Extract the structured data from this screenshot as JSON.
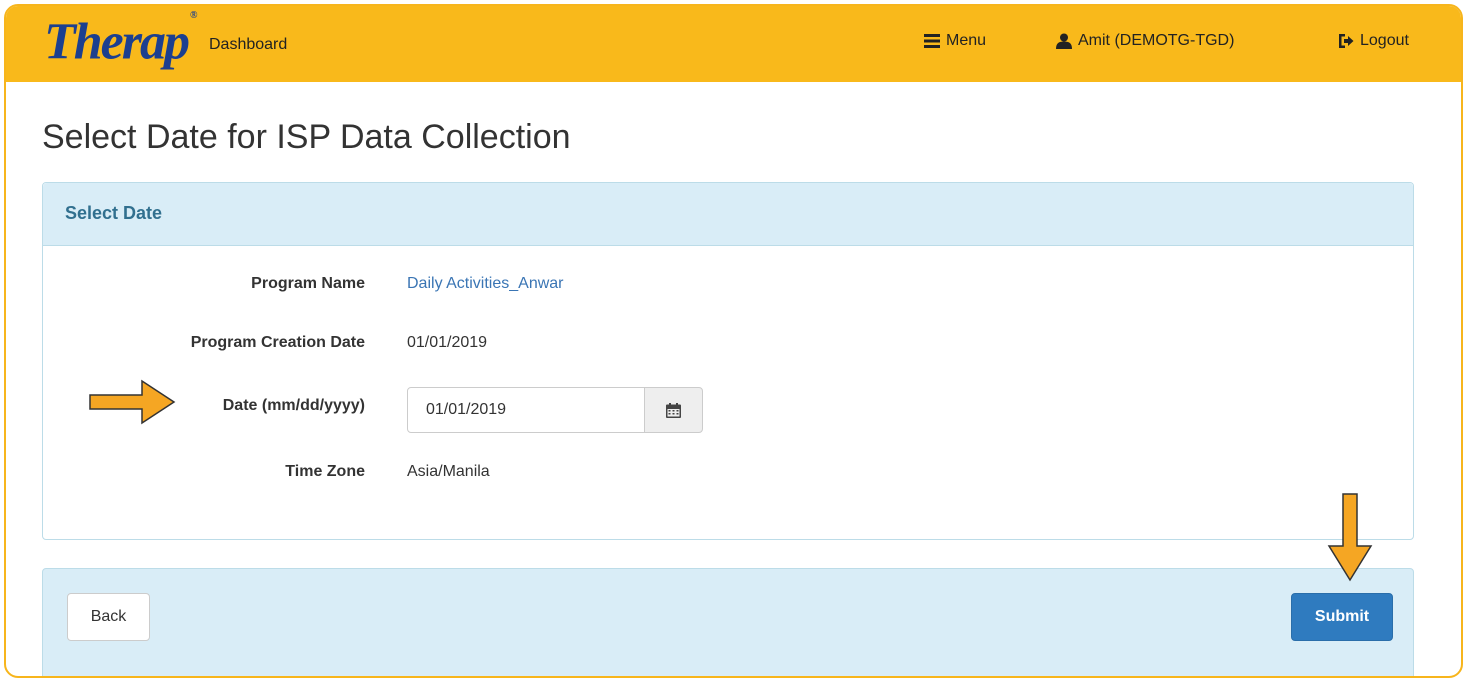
{
  "header": {
    "logo_text": "Therap",
    "dashboard_label": "Dashboard",
    "menu_label": "Menu",
    "user_label": "Amit (DEMOTG-TGD)",
    "logout_label": "Logout",
    "brand_color": "#f9b91b"
  },
  "page": {
    "title": "Select Date for ISP Data Collection"
  },
  "panel": {
    "title": "Select Date",
    "fields": {
      "program_name_label": "Program Name",
      "program_name_value": "Daily Activities_Anwar",
      "creation_date_label": "Program Creation Date",
      "creation_date_value": "01/01/2019",
      "date_label": "Date (mm/dd/yyyy)",
      "date_value": "01/01/2019",
      "timezone_label": "Time Zone",
      "timezone_value": "Asia/Manila"
    }
  },
  "footer": {
    "back_label": "Back",
    "submit_label": "Submit"
  },
  "icons": [
    "hamburger-icon",
    "user-icon",
    "logout-icon",
    "calendar-icon",
    "arrow-right-icon",
    "arrow-down-icon"
  ]
}
